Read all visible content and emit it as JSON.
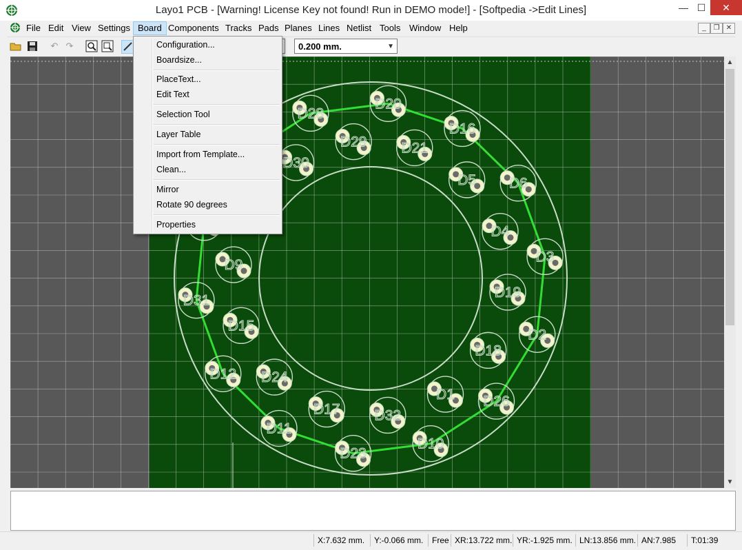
{
  "window": {
    "title": "Layo1 PCB - [Warning! License Key not found! Run in DEMO mode!] - [Softpedia ->Edit Lines]",
    "min_label": "—",
    "max_label": "☐",
    "close_label": "✕"
  },
  "menubar": {
    "items": [
      "File",
      "Edit",
      "View",
      "Settings",
      "Board",
      "Components",
      "Tracks",
      "Pads",
      "Planes",
      "Lines",
      "Netlist",
      "Tools",
      "Window",
      "Help"
    ],
    "active": "Board"
  },
  "toolbar": {
    "icons": [
      "open-folder-icon",
      "save-icon",
      "undo-icon",
      "redo-icon",
      "zoom-icon",
      "zoom-fit-icon",
      "pen-icon"
    ],
    "width_combo_value": "0.200 mm."
  },
  "board_menu": {
    "groups": [
      [
        "Configuration...",
        "Boardsize..."
      ],
      [
        "PlaceText...",
        "Edit Text"
      ],
      [
        "Selection Tool"
      ],
      [
        "Layer Table"
      ],
      [
        "Import from Template...",
        "Clean..."
      ],
      [
        "Mirror",
        "Rotate 90 degrees"
      ],
      [
        "Properties"
      ]
    ]
  },
  "pcb": {
    "components": [
      "D20",
      "D21",
      "D16",
      "D5",
      "D6",
      "D4",
      "D3",
      "D19",
      "D2",
      "D18",
      "D26",
      "D1",
      "D10",
      "D32",
      "D23",
      "D17",
      "D11",
      "D24",
      "D12",
      "D15",
      "D31",
      "D9",
      "D14",
      "D27",
      "D13",
      "D30",
      "D28",
      "D29"
    ],
    "board_color": "#0a4a0a",
    "track_color": "#33dd33",
    "silk_color": "#c8dcc8"
  },
  "status": {
    "x": "X:7.632 mm.",
    "y": "Y:-0.066 mm.",
    "mode": "Free",
    "xr": "XR:13.722 mm.",
    "yr": "YR:-1.925 mm.",
    "ln": "LN:13.856 mm.",
    "an": "AN:7.985",
    "t": "T:01:39"
  }
}
